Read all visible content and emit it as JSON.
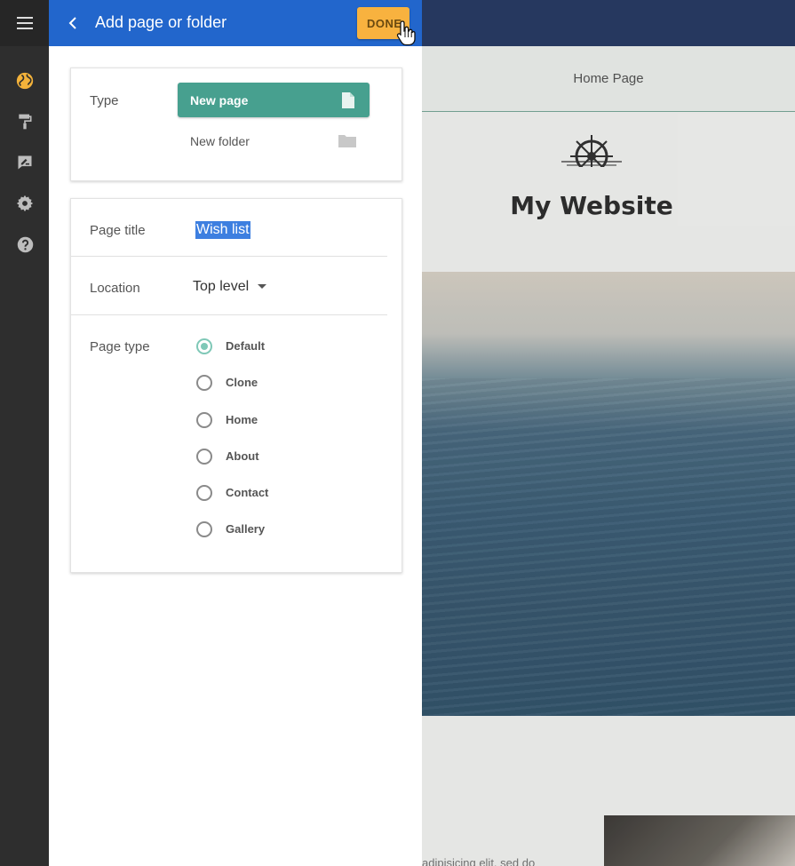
{
  "panel": {
    "title": "Add page or folder",
    "done_label": "DONE"
  },
  "type_section": {
    "label": "Type",
    "new_page_label": "New page",
    "new_folder_label": "New folder",
    "selected": "New page"
  },
  "page_title": {
    "label": "Page title",
    "value": "Wish list"
  },
  "location": {
    "label": "Location",
    "value": "Top level"
  },
  "page_type": {
    "label": "Page type",
    "selected": "Default",
    "options": [
      "Default",
      "Clone",
      "Home",
      "About",
      "Contact",
      "Gallery"
    ]
  },
  "preview": {
    "nav_item": "Home Page",
    "site_title": "My Website",
    "snippet": "adipisicing elit, sed do"
  },
  "sidebar": {
    "icons": [
      "menu-icon",
      "globe-icon",
      "paint-roller-icon",
      "edit-note-icon",
      "gear-icon",
      "help-icon"
    ]
  },
  "colors": {
    "header": "#2266cc",
    "done_button": "#f8b23f",
    "new_page_button": "#47a08f",
    "radio_selected": "#7fc8b7",
    "globe_active": "#f3b23a",
    "site_topbar": "#26385f"
  }
}
